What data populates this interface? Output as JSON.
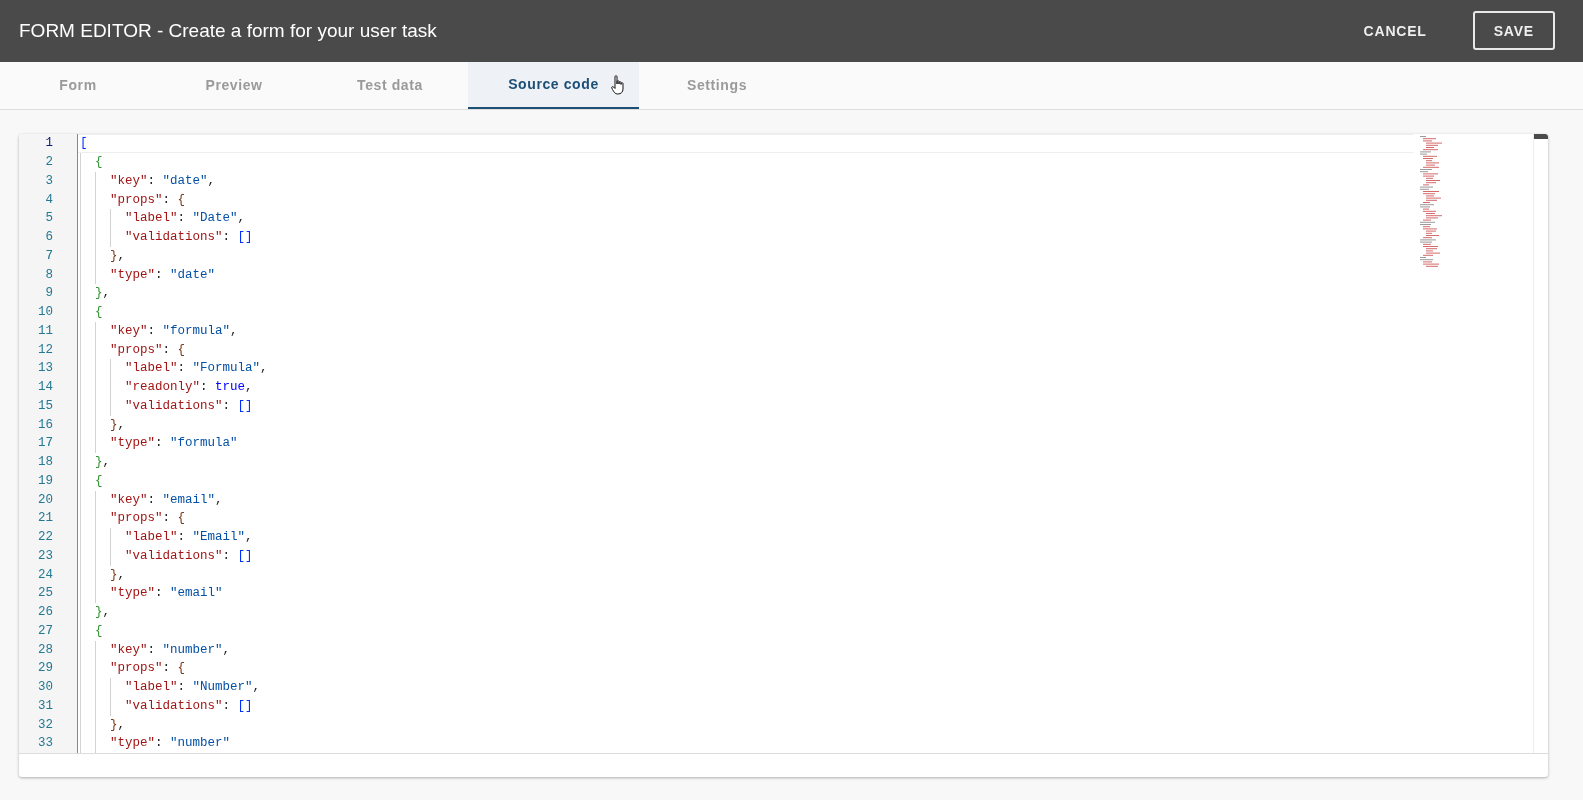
{
  "header": {
    "title": "FORM EDITOR - Create a form for your user task",
    "buttons": [
      {
        "label": "CANCEL",
        "kind": "text"
      },
      {
        "label": "SAVE",
        "kind": "outlined"
      }
    ]
  },
  "tabs": [
    {
      "label": "Form",
      "selected": false
    },
    {
      "label": "Preview",
      "selected": false
    },
    {
      "label": "Test data",
      "selected": false
    },
    {
      "label": "Source code",
      "selected": true
    },
    {
      "label": "Settings",
      "selected": false
    }
  ],
  "editor": {
    "lines": [
      {
        "number": "1",
        "active": true,
        "tokens": [
          {
            "kind": "open",
            "text": "["
          }
        ]
      },
      {
        "number": "2",
        "active": false,
        "tokens": [
          {
            "kind": "open",
            "text": "{"
          }
        ]
      },
      {
        "number": "3",
        "active": false,
        "tokens": [
          {
            "kind": "key",
            "text": "\"key\""
          },
          {
            "kind": "punct",
            "text": ": "
          },
          {
            "kind": "string",
            "text": "\"date\""
          },
          {
            "kind": "punct",
            "text": ","
          }
        ]
      },
      {
        "number": "4",
        "active": false,
        "tokens": [
          {
            "kind": "key",
            "text": "\"props\""
          },
          {
            "kind": "punct",
            "text": ": "
          },
          {
            "kind": "open",
            "text": "{"
          }
        ]
      },
      {
        "number": "5",
        "active": false,
        "tokens": [
          {
            "kind": "key",
            "text": "\"label\""
          },
          {
            "kind": "punct",
            "text": ": "
          },
          {
            "kind": "string",
            "text": "\"Date\""
          },
          {
            "kind": "punct",
            "text": ","
          }
        ]
      },
      {
        "number": "6",
        "active": false,
        "tokens": [
          {
            "kind": "key",
            "text": "\"validations\""
          },
          {
            "kind": "punct",
            "text": ": "
          },
          {
            "kind": "open",
            "text": "["
          },
          {
            "kind": "close",
            "text": "]"
          }
        ]
      },
      {
        "number": "7",
        "active": false,
        "tokens": [
          {
            "kind": "close",
            "text": "}"
          },
          {
            "kind": "punct",
            "text": ","
          }
        ]
      },
      {
        "number": "8",
        "active": false,
        "tokens": [
          {
            "kind": "key",
            "text": "\"type\""
          },
          {
            "kind": "punct",
            "text": ": "
          },
          {
            "kind": "string",
            "text": "\"date\""
          }
        ]
      },
      {
        "number": "9",
        "active": false,
        "tokens": [
          {
            "kind": "close",
            "text": "}"
          },
          {
            "kind": "punct",
            "text": ","
          }
        ]
      },
      {
        "number": "10",
        "active": false,
        "tokens": [
          {
            "kind": "open",
            "text": "{"
          }
        ]
      },
      {
        "number": "11",
        "active": false,
        "tokens": [
          {
            "kind": "key",
            "text": "\"key\""
          },
          {
            "kind": "punct",
            "text": ": "
          },
          {
            "kind": "string",
            "text": "\"formula\""
          },
          {
            "kind": "punct",
            "text": ","
          }
        ]
      },
      {
        "number": "12",
        "active": false,
        "tokens": [
          {
            "kind": "key",
            "text": "\"props\""
          },
          {
            "kind": "punct",
            "text": ": "
          },
          {
            "kind": "open",
            "text": "{"
          }
        ]
      },
      {
        "number": "13",
        "active": false,
        "tokens": [
          {
            "kind": "key",
            "text": "\"label\""
          },
          {
            "kind": "punct",
            "text": ": "
          },
          {
            "kind": "string",
            "text": "\"Formula\""
          },
          {
            "kind": "punct",
            "text": ","
          }
        ]
      },
      {
        "number": "14",
        "active": false,
        "tokens": [
          {
            "kind": "key",
            "text": "\"readonly\""
          },
          {
            "kind": "punct",
            "text": ": "
          },
          {
            "kind": "keyword",
            "text": "true"
          },
          {
            "kind": "punct",
            "text": ","
          }
        ]
      },
      {
        "number": "15",
        "active": false,
        "tokens": [
          {
            "kind": "key",
            "text": "\"validations\""
          },
          {
            "kind": "punct",
            "text": ": "
          },
          {
            "kind": "open",
            "text": "["
          },
          {
            "kind": "close",
            "text": "]"
          }
        ]
      },
      {
        "number": "16",
        "active": false,
        "tokens": [
          {
            "kind": "close",
            "text": "}"
          },
          {
            "kind": "punct",
            "text": ","
          }
        ]
      },
      {
        "number": "17",
        "active": false,
        "tokens": [
          {
            "kind": "key",
            "text": "\"type\""
          },
          {
            "kind": "punct",
            "text": ": "
          },
          {
            "kind": "string",
            "text": "\"formula\""
          }
        ]
      },
      {
        "number": "18",
        "active": false,
        "tokens": [
          {
            "kind": "close",
            "text": "}"
          },
          {
            "kind": "punct",
            "text": ","
          }
        ]
      },
      {
        "number": "19",
        "active": false,
        "tokens": [
          {
            "kind": "open",
            "text": "{"
          }
        ]
      },
      {
        "number": "20",
        "active": false,
        "tokens": [
          {
            "kind": "key",
            "text": "\"key\""
          },
          {
            "kind": "punct",
            "text": ": "
          },
          {
            "kind": "string",
            "text": "\"email\""
          },
          {
            "kind": "punct",
            "text": ","
          }
        ]
      },
      {
        "number": "21",
        "active": false,
        "tokens": [
          {
            "kind": "key",
            "text": "\"props\""
          },
          {
            "kind": "punct",
            "text": ": "
          },
          {
            "kind": "open",
            "text": "{"
          }
        ]
      },
      {
        "number": "22",
        "active": false,
        "tokens": [
          {
            "kind": "key",
            "text": "\"label\""
          },
          {
            "kind": "punct",
            "text": ": "
          },
          {
            "kind": "string",
            "text": "\"Email\""
          },
          {
            "kind": "punct",
            "text": ","
          }
        ]
      },
      {
        "number": "23",
        "active": false,
        "tokens": [
          {
            "kind": "key",
            "text": "\"validations\""
          },
          {
            "kind": "punct",
            "text": ": "
          },
          {
            "kind": "open",
            "text": "["
          },
          {
            "kind": "close",
            "text": "]"
          }
        ]
      },
      {
        "number": "24",
        "active": false,
        "tokens": [
          {
            "kind": "close",
            "text": "}"
          },
          {
            "kind": "punct",
            "text": ","
          }
        ]
      },
      {
        "number": "25",
        "active": false,
        "tokens": [
          {
            "kind": "key",
            "text": "\"type\""
          },
          {
            "kind": "punct",
            "text": ": "
          },
          {
            "kind": "string",
            "text": "\"email\""
          }
        ]
      },
      {
        "number": "26",
        "active": false,
        "tokens": [
          {
            "kind": "close",
            "text": "}"
          },
          {
            "kind": "punct",
            "text": ","
          }
        ]
      },
      {
        "number": "27",
        "active": false,
        "tokens": [
          {
            "kind": "open",
            "text": "{"
          }
        ]
      },
      {
        "number": "28",
        "active": false,
        "tokens": [
          {
            "kind": "key",
            "text": "\"key\""
          },
          {
            "kind": "punct",
            "text": ": "
          },
          {
            "kind": "string",
            "text": "\"number\""
          },
          {
            "kind": "punct",
            "text": ","
          }
        ]
      },
      {
        "number": "29",
        "active": false,
        "tokens": [
          {
            "kind": "key",
            "text": "\"props\""
          },
          {
            "kind": "punct",
            "text": ": "
          },
          {
            "kind": "open",
            "text": "{"
          }
        ]
      },
      {
        "number": "30",
        "active": false,
        "tokens": [
          {
            "kind": "key",
            "text": "\"label\""
          },
          {
            "kind": "punct",
            "text": ": "
          },
          {
            "kind": "string",
            "text": "\"Number\""
          },
          {
            "kind": "punct",
            "text": ","
          }
        ]
      },
      {
        "number": "31",
        "active": false,
        "tokens": [
          {
            "kind": "key",
            "text": "\"validations\""
          },
          {
            "kind": "punct",
            "text": ": "
          },
          {
            "kind": "open",
            "text": "["
          },
          {
            "kind": "close",
            "text": "]"
          }
        ]
      },
      {
        "number": "32",
        "active": false,
        "tokens": [
          {
            "kind": "close",
            "text": "}"
          },
          {
            "kind": "punct",
            "text": ","
          }
        ]
      },
      {
        "number": "33",
        "active": false,
        "tokens": [
          {
            "kind": "key",
            "text": "\"type\""
          },
          {
            "kind": "punct",
            "text": ": "
          },
          {
            "kind": "string",
            "text": "\"number\""
          }
        ]
      }
    ]
  }
}
